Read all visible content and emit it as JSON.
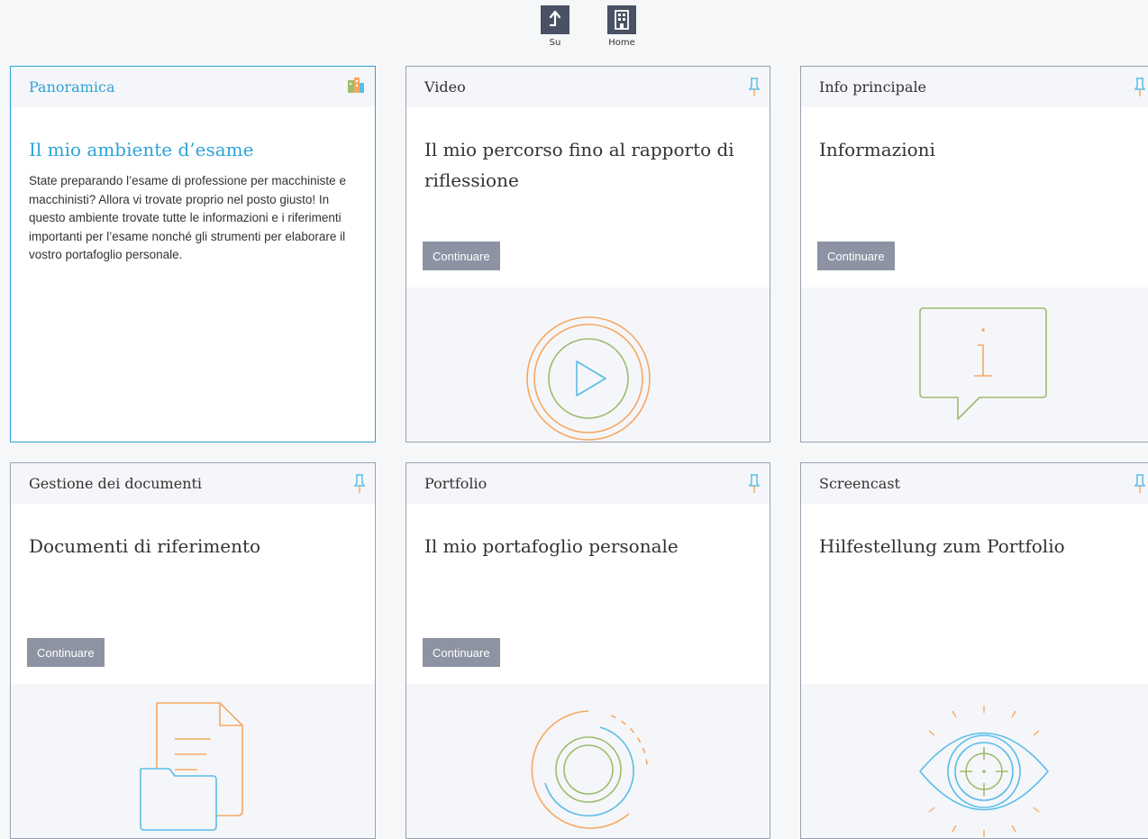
{
  "nav": {
    "up_label": "Su",
    "home_label": "Home"
  },
  "cards": [
    {
      "header": "Panoramica",
      "title": "Il mio ambiente d’esame",
      "description": "State preparando l’esame di professione per macchiniste e macchinisti? Allora vi trovate proprio nel posto giusto! In questo ambiente trovate tutte le informazioni e i riferimenti importanti per l’esame nonché gli strumenti per elaborare il vostro portafoglio personale.",
      "icon": "building-icon"
    },
    {
      "header": "Video",
      "title": "Il mio percorso fino al rapporto di riflessione",
      "button": "Continuare",
      "icon": "pin-icon",
      "art": "play-icon"
    },
    {
      "header": "Info principale",
      "title": "Informazioni",
      "button": "Continuare",
      "icon": "pin-icon",
      "art": "info-icon"
    },
    {
      "header": "Gestione dei documenti",
      "title": "Documenti di riferimento",
      "button": "Continuare",
      "icon": "pin-icon",
      "art": "documents-icon"
    },
    {
      "header": "Portfolio",
      "title": "Il mio portafoglio personale",
      "button": "Continuare",
      "icon": "pin-icon",
      "art": "portfolio-icon"
    },
    {
      "header": "Screencast",
      "title": "Hilfestellung zum Portfolio",
      "icon": "pin-icon",
      "art": "eye-icon"
    }
  ],
  "colors": {
    "accent": "#2ea3d6",
    "border": "#9aa0b0",
    "button": "#8d93a3",
    "header_bg": "#f5f6f9",
    "nav_bg": "#4a5164",
    "orange": "#f5a862",
    "green": "#9dbc6e",
    "blue": "#59bde8"
  }
}
